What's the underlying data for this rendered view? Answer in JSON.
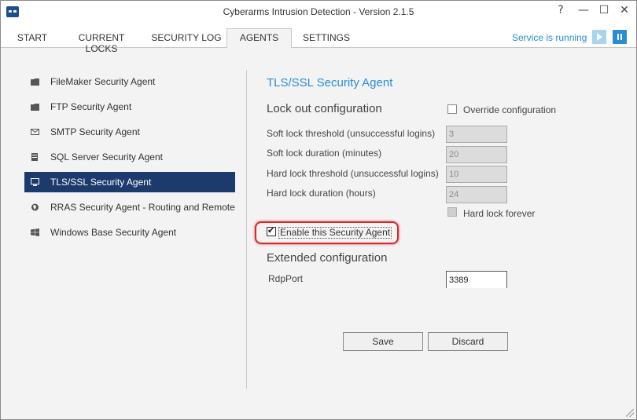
{
  "window": {
    "title": "Cyberarms Intrusion Detection - Version 2.1.5",
    "help_glyph": "?",
    "minimize_glyph": "—",
    "maximize_glyph": "☐",
    "close_glyph": "✕"
  },
  "tabs": [
    {
      "label": "START"
    },
    {
      "label": "CURRENT LOCKS"
    },
    {
      "label": "SECURITY LOG"
    },
    {
      "label": "AGENTS",
      "active": true
    },
    {
      "label": "SETTINGS"
    }
  ],
  "service": {
    "status_text": "Service is running",
    "accent_color": "#2a8dd4"
  },
  "sidebar": {
    "items": [
      {
        "label": "FileMaker Security Agent",
        "icon": "folder-icon"
      },
      {
        "label": "FTP Security Agent",
        "icon": "folder-icon"
      },
      {
        "label": "SMTP Security Agent",
        "icon": "envelope-icon"
      },
      {
        "label": "SQL Server Security Agent",
        "icon": "database-icon"
      },
      {
        "label": "TLS/SSL Security Agent",
        "icon": "monitor-icon",
        "active": true
      },
      {
        "label": "RRAS Security Agent - Routing and Remote",
        "icon": "globe-icon"
      },
      {
        "label": "Windows Base Security Agent",
        "icon": "windows-icon"
      }
    ],
    "active_color": "#1c3a6b"
  },
  "panel": {
    "title": "TLS/SSL Security Agent",
    "lockout": {
      "heading": "Lock out configuration",
      "override_label": "Override configuration",
      "override_checked": false,
      "fields": [
        {
          "label": "Soft lock threshold (unsuccessful logins)",
          "value": "3"
        },
        {
          "label": "Soft lock duration (minutes)",
          "value": "20"
        },
        {
          "label": "Hard lock threshold (unsuccessful logins)",
          "value": "10"
        },
        {
          "label": "Hard lock duration (hours)",
          "value": "24"
        }
      ],
      "hard_lock_forever_label": "Hard lock forever",
      "hard_lock_forever_checked": false
    },
    "enable_label": "Enable this Security Agent",
    "enable_checked": true,
    "extended": {
      "heading": "Extended configuration",
      "rdp_label": "RdpPort",
      "rdp_value": "3389"
    },
    "buttons": {
      "save_label": "Save",
      "discard_label": "Discard"
    }
  }
}
